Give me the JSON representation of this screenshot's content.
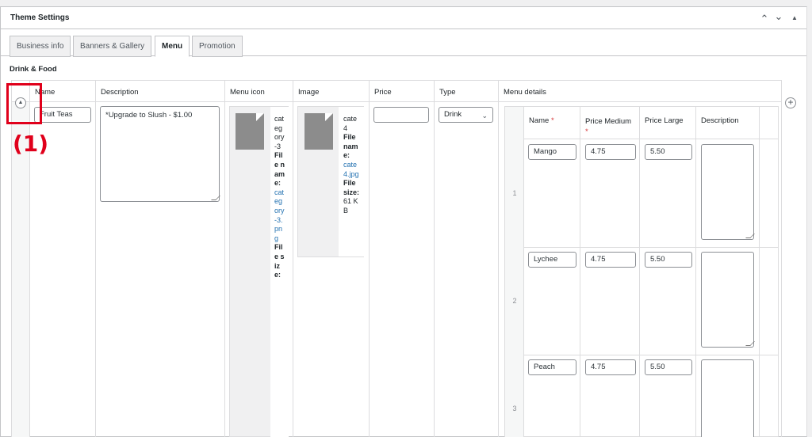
{
  "panel": {
    "title": "Theme Settings",
    "controls": {
      "up": "⌃",
      "down": "⌄",
      "collapse": "▲"
    }
  },
  "tabs": [
    {
      "label": "Business info",
      "active": false
    },
    {
      "label": "Banners & Gallery",
      "active": false
    },
    {
      "label": "Menu",
      "active": true
    },
    {
      "label": "Promotion",
      "active": false
    }
  ],
  "section": {
    "title": "Drink & Food"
  },
  "columns": {
    "name": "Name",
    "description": "Description",
    "menu_icon": "Menu icon",
    "image": "Image",
    "price": "Price",
    "type": "Type",
    "menu_details": "Menu details"
  },
  "row": {
    "name": "Fruit Teas",
    "description": "*Upgrade to Slush - $1.00",
    "menu_icon": {
      "title": "category-3",
      "filename_label": "File name:",
      "filename": "category-3.png",
      "filesize_label": "File size:",
      "filesize": ""
    },
    "image": {
      "title": "cate4",
      "filename_label": "File name:",
      "filename": "cate4.jpg",
      "filesize_label": "File size:",
      "filesize": "61 KB"
    },
    "price": "",
    "type": "Drink"
  },
  "menu_details": {
    "headers": {
      "name": "Name",
      "required": "*",
      "price_medium": "Price Medium",
      "price_large": "Price Large",
      "description": "Description"
    },
    "items": [
      {
        "num": "1",
        "name": "Mango",
        "price_medium": "4.75",
        "price_large": "5.50",
        "description": ""
      },
      {
        "num": "2",
        "name": "Lychee",
        "price_medium": "4.75",
        "price_large": "5.50",
        "description": ""
      },
      {
        "num": "3",
        "name": "Peach",
        "price_medium": "4.75",
        "price_large": "5.50",
        "description": ""
      }
    ]
  },
  "annotation": {
    "label": "(1)",
    "color": "#e0001b"
  },
  "icons": {
    "collapse_row": "chevron-up-circle-icon",
    "add_row": "plus-circle-icon"
  }
}
